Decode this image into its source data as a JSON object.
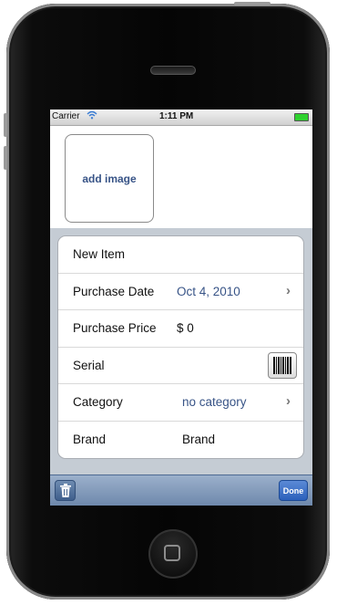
{
  "status_bar": {
    "carrier": "Carrier",
    "time": "1:11 PM"
  },
  "image_button": {
    "label": "add image"
  },
  "form": {
    "rows": [
      {
        "label": "New Item"
      },
      {
        "label": "Purchase Date",
        "value": "Oct 4, 2010"
      },
      {
        "label": "Purchase Price",
        "value": "$ 0"
      },
      {
        "label": "Serial"
      },
      {
        "label": "Category",
        "value": "no category"
      },
      {
        "label": "Brand",
        "value": "Brand"
      }
    ]
  },
  "toolbar": {
    "done_label": "Done"
  },
  "icons": {
    "wifi": "wifi-icon",
    "battery": "battery-icon",
    "chevron": "chevron-right-icon",
    "barcode": "barcode-icon",
    "trash": "trash-icon",
    "home": "home-button-icon"
  },
  "colors": {
    "accent": "#385487",
    "toolbar": "#6d87ab",
    "done": "#2b60bb",
    "background": "#c5ccd4"
  }
}
